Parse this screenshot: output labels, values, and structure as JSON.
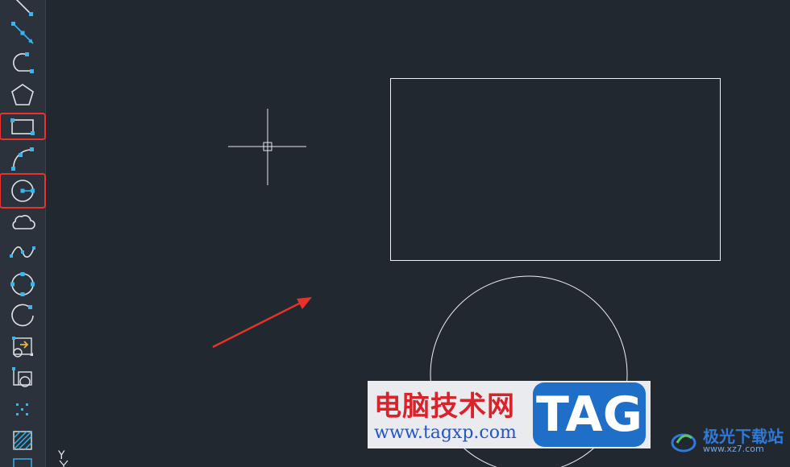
{
  "toolbar": {
    "tools": [
      {
        "name": "line"
      },
      {
        "name": "construction-line"
      },
      {
        "name": "polyline"
      },
      {
        "name": "polygon"
      },
      {
        "name": "rectangle",
        "selected": true
      },
      {
        "name": "arc"
      },
      {
        "name": "circle",
        "selected": true
      },
      {
        "name": "revision-cloud"
      },
      {
        "name": "spline"
      },
      {
        "name": "ellipse"
      },
      {
        "name": "ellipse-arc"
      },
      {
        "name": "insert-block"
      },
      {
        "name": "make-block"
      },
      {
        "name": "point"
      },
      {
        "name": "hatch"
      }
    ]
  },
  "colors": {
    "accent": "#e8332e",
    "icon_blue": "#38b6f0",
    "canvas": "#212830"
  },
  "canvas": {
    "ucs_label": "Y"
  },
  "watermark": {
    "cn": "电脑技术网",
    "url": "www.tagxp.com",
    "tag": "TAG"
  },
  "brand": {
    "name": "极光下载站",
    "url": "www.xz7.com"
  }
}
